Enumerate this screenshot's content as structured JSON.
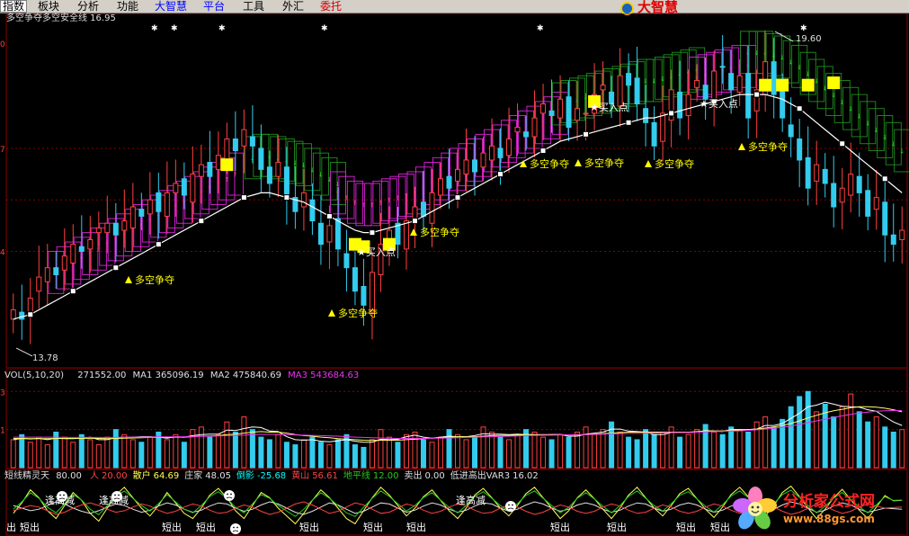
{
  "menu": {
    "items": [
      {
        "label": "指数",
        "style": "first"
      },
      {
        "label": "板块",
        "style": ""
      },
      {
        "label": "分析",
        "style": ""
      },
      {
        "label": "功能",
        "style": ""
      },
      {
        "label": "大智慧",
        "style": "hl"
      },
      {
        "label": "平台",
        "style": "hl"
      },
      {
        "label": "工具",
        "style": ""
      },
      {
        "label": "外汇",
        "style": ""
      },
      {
        "label": "委托",
        "style": "red"
      }
    ],
    "brand": "大智慧"
  },
  "colors": {
    "up": "#ff4040",
    "down": "#33ccee",
    "white": "#ffffff",
    "magenta": "#dd22dd",
    "green": "#1f8f1f",
    "yellow": "#ffff00",
    "vol_ma2": "#ffff66",
    "vol_ma3": "#ee33ee",
    "grid": "#8b0000"
  },
  "main_panel": {
    "title": "多空争夺多空安全线 16.95",
    "axis_labels": [
      "0",
      "7",
      "4"
    ],
    "high_label": "19.60",
    "low_label": "13.78",
    "signal_text": "多空争夺",
    "buy_text": "买入点"
  },
  "volume_panel": {
    "title": "VOL(5,10,20)",
    "volume": "271552.00",
    "ma1_label": "MA1",
    "ma1": "365096.19",
    "ma2_label": "MA2",
    "ma2": "475840.69",
    "ma3_label": "MA3",
    "ma3": "543684.63",
    "axis_labels": [
      "3",
      "1"
    ]
  },
  "indicator_panel": {
    "name": "短线精灵天",
    "name_value": "80.00",
    "fields": [
      {
        "label": "人",
        "value": "20.00",
        "color": "#ff4444"
      },
      {
        "label": "散户",
        "value": "64.69",
        "color": "#ffff55"
      },
      {
        "label": "庄家",
        "value": "48.05",
        "color": "#e0e0e0"
      },
      {
        "label": "倒影",
        "value": "-25.68",
        "color": "#00ffff"
      },
      {
        "label": "黄山",
        "value": "56.61",
        "color": "#ff4444"
      },
      {
        "label": "地平线",
        "value": "12.00",
        "color": "#22cc22"
      },
      {
        "label": "卖出",
        "value": "0.00",
        "color": "#e0e0e0"
      },
      {
        "label": "低进高出VAR3",
        "value": "16.02",
        "color": "#e0e0e0"
      }
    ],
    "marker_text_short": "短出",
    "marker_text_reduce": "逢高减",
    "partial_label": "出"
  },
  "watermark": {
    "title": "分析家公式网",
    "url": "www.88gs.com"
  },
  "chart_data": [
    {
      "type": "candlestick",
      "title": "多空争夺多空安全线 16.95",
      "ylim": [
        13.0,
        20.3
      ],
      "high": 19.6,
      "low": 13.78,
      "close": [
        14.2,
        14.0,
        14.45,
        14.9,
        15.1,
        14.95,
        15.35,
        15.6,
        15.45,
        15.7,
        15.95,
        16.05,
        15.8,
        16.1,
        16.4,
        16.2,
        16.55,
        16.3,
        16.7,
        16.9,
        16.65,
        17.1,
        17.3,
        17.05,
        17.5,
        17.85,
        17.6,
        18.05,
        17.7,
        17.2,
        16.9,
        17.35,
        16.6,
        16.3,
        16.7,
        16.1,
        15.6,
        16.0,
        15.5,
        15.1,
        14.6,
        14.3,
        15.0,
        15.6,
        15.9,
        15.6,
        16.1,
        16.4,
        16.2,
        16.7,
        17.0,
        16.8,
        17.2,
        17.4,
        17.15,
        17.55,
        17.7,
        17.45,
        17.85,
        18.1,
        17.9,
        18.3,
        18.6,
        18.35,
        18.7,
        18.1,
        18.5,
        18.4,
        18.8,
        19.0,
        18.6,
        19.2,
        19.0,
        18.6,
        18.2,
        17.7,
        18.4,
        18.9,
        18.3,
        18.8,
        19.1,
        18.7,
        19.3,
        19.4,
        18.9,
        19.2,
        18.3,
        18.9,
        19.5,
        18.8,
        18.3,
        17.9,
        17.4,
        16.8,
        17.3,
        16.9,
        16.4,
        16.8,
        17.1,
        16.7,
        16.2,
        16.6,
        15.8,
        15.6,
        15.9
      ],
      "safety_line": [
        14.0,
        14.05,
        14.1,
        14.2,
        14.3,
        14.4,
        14.5,
        14.6,
        14.7,
        14.8,
        14.9,
        15.0,
        15.1,
        15.2,
        15.3,
        15.4,
        15.5,
        15.6,
        15.7,
        15.8,
        15.9,
        16.0,
        16.1,
        16.2,
        16.3,
        16.4,
        16.5,
        16.6,
        16.65,
        16.7,
        16.7,
        16.65,
        16.6,
        16.55,
        16.5,
        16.4,
        16.3,
        16.2,
        16.1,
        16.0,
        15.9,
        15.85,
        15.85,
        15.9,
        15.95,
        16.0,
        16.05,
        16.1,
        16.2,
        16.3,
        16.4,
        16.5,
        16.6,
        16.7,
        16.8,
        16.9,
        17.0,
        17.1,
        17.2,
        17.3,
        17.4,
        17.5,
        17.6,
        17.7,
        17.8,
        17.85,
        17.9,
        17.95,
        18.0,
        18.05,
        18.1,
        18.15,
        18.2,
        18.25,
        18.3,
        18.3,
        18.35,
        18.4,
        18.45,
        18.5,
        18.55,
        18.6,
        18.65,
        18.7,
        18.75,
        18.8,
        18.8,
        18.8,
        18.8,
        18.75,
        18.7,
        18.6,
        18.5,
        18.35,
        18.2,
        18.05,
        17.9,
        17.75,
        17.6,
        17.45,
        17.3,
        17.15,
        17.0,
        16.85,
        16.7
      ]
    },
    {
      "type": "bar",
      "title": "VOL(5,10,20)",
      "series": [
        {
          "name": "VOL",
          "values": [
            1.1,
            1.3,
            1.0,
            1.2,
            0.9,
            1.4,
            1.2,
            1.0,
            1.3,
            1.1,
            0.9,
            1.2,
            1.5,
            1.3,
            1.1,
            1.0,
            1.2,
            1.4,
            1.1,
            1.3,
            1.0,
            1.5,
            1.6,
            1.2,
            1.3,
            1.8,
            1.4,
            2.0,
            1.5,
            1.2,
            1.1,
            1.3,
            1.0,
            0.9,
            1.1,
            1.2,
            1.0,
            0.9,
            1.1,
            1.3,
            0.9,
            0.8,
            1.1,
            1.5,
            1.2,
            1.0,
            1.3,
            1.4,
            1.1,
            1.0,
            1.2,
            1.5,
            1.3,
            1.1,
            1.2,
            1.6,
            1.4,
            1.2,
            1.1,
            1.3,
            1.5,
            1.4,
            1.2,
            1.1,
            1.3,
            1.2,
            1.4,
            1.6,
            1.3,
            1.5,
            1.8,
            1.4,
            1.2,
            1.1,
            1.5,
            1.3,
            1.4,
            1.6,
            1.2,
            1.3,
            1.5,
            1.7,
            1.4,
            1.3,
            1.6,
            1.5,
            1.4,
            1.8,
            2.0,
            1.6,
            1.9,
            2.4,
            2.8,
            3.0,
            2.2,
            2.5,
            2.0,
            2.4,
            2.9,
            2.2,
            1.8,
            2.0,
            1.6,
            1.4,
            1.5
          ]
        },
        {
          "name": "MA1",
          "values": [
            1.1,
            1.15,
            1.13,
            1.15,
            1.1,
            1.16,
            1.14,
            1.14,
            1.16,
            1.2,
            1.1,
            1.1,
            1.18,
            1.2,
            1.2,
            1.22,
            1.22,
            1.2,
            1.16,
            1.22,
            1.2,
            1.26,
            1.3,
            1.32,
            1.32,
            1.48,
            1.46,
            1.54,
            1.6,
            1.58,
            1.44,
            1.42,
            1.22,
            1.1,
            1.08,
            1.1,
            1.04,
            1.02,
            1.06,
            1.1,
            1.04,
            1.0,
            1.0,
            1.12,
            1.1,
            1.12,
            1.22,
            1.28,
            1.2,
            1.16,
            1.2,
            1.24,
            1.22,
            1.22,
            1.26,
            1.34,
            1.32,
            1.32,
            1.3,
            1.32,
            1.3,
            1.3,
            1.28,
            1.3,
            1.3,
            1.24,
            1.24,
            1.32,
            1.36,
            1.4,
            1.52,
            1.52,
            1.44,
            1.42,
            1.4,
            1.3,
            1.3,
            1.38,
            1.4,
            1.38,
            1.4,
            1.46,
            1.44,
            1.42,
            1.5,
            1.5,
            1.5,
            1.52,
            1.66,
            1.66,
            1.74,
            1.94,
            2.14,
            2.4,
            2.46,
            2.58,
            2.5,
            2.42,
            2.4,
            2.38,
            2.28,
            2.22,
            2.0,
            1.8,
            1.66
          ]
        },
        {
          "name": "MA2",
          "values": [
            1.15,
            1.15,
            1.14,
            1.14,
            1.14,
            1.15,
            1.15,
            1.15,
            1.15,
            1.16,
            1.15,
            1.14,
            1.15,
            1.16,
            1.17,
            1.18,
            1.19,
            1.19,
            1.19,
            1.2,
            1.2,
            1.22,
            1.24,
            1.25,
            1.26,
            1.3,
            1.32,
            1.36,
            1.4,
            1.42,
            1.4,
            1.4,
            1.36,
            1.3,
            1.26,
            1.24,
            1.2,
            1.18,
            1.14,
            1.12,
            1.1,
            1.08,
            1.07,
            1.08,
            1.08,
            1.08,
            1.1,
            1.12,
            1.14,
            1.16,
            1.18,
            1.2,
            1.22,
            1.22,
            1.22,
            1.24,
            1.26,
            1.27,
            1.27,
            1.28,
            1.3,
            1.3,
            1.3,
            1.3,
            1.3,
            1.29,
            1.29,
            1.3,
            1.32,
            1.34,
            1.36,
            1.38,
            1.4,
            1.4,
            1.4,
            1.4,
            1.4,
            1.4,
            1.4,
            1.4,
            1.42,
            1.44,
            1.44,
            1.45,
            1.46,
            1.48,
            1.5,
            1.52,
            1.56,
            1.6,
            1.66,
            1.74,
            1.84,
            1.96,
            2.06,
            2.16,
            2.24,
            2.3,
            2.36,
            2.4,
            2.4,
            2.38,
            2.34,
            2.28,
            2.2
          ]
        },
        {
          "name": "MA3",
          "values": [
            1.2,
            1.2,
            1.2,
            1.2,
            1.2,
            1.2,
            1.19,
            1.19,
            1.19,
            1.19,
            1.19,
            1.19,
            1.19,
            1.2,
            1.2,
            1.2,
            1.2,
            1.21,
            1.21,
            1.21,
            1.22,
            1.22,
            1.23,
            1.24,
            1.25,
            1.26,
            1.27,
            1.28,
            1.3,
            1.31,
            1.31,
            1.31,
            1.3,
            1.29,
            1.28,
            1.27,
            1.26,
            1.25,
            1.24,
            1.22,
            1.2,
            1.19,
            1.18,
            1.17,
            1.16,
            1.15,
            1.15,
            1.15,
            1.15,
            1.16,
            1.16,
            1.17,
            1.18,
            1.19,
            1.2,
            1.21,
            1.22,
            1.23,
            1.24,
            1.25,
            1.26,
            1.27,
            1.28,
            1.28,
            1.29,
            1.29,
            1.3,
            1.3,
            1.31,
            1.32,
            1.33,
            1.34,
            1.35,
            1.35,
            1.36,
            1.36,
            1.37,
            1.38,
            1.38,
            1.39,
            1.4,
            1.41,
            1.42,
            1.43,
            1.44,
            1.45,
            1.47,
            1.49,
            1.52,
            1.55,
            1.59,
            1.64,
            1.7,
            1.77,
            1.84,
            1.91,
            1.98,
            2.04,
            2.1,
            2.15,
            2.19,
            2.22,
            2.24,
            2.25,
            2.25
          ]
        }
      ],
      "ylim": [
        0,
        3.4
      ]
    },
    {
      "type": "line",
      "title": "短线精灵天",
      "ylim": [
        0,
        100
      ],
      "series": [
        {
          "name": "散户",
          "values": [
            40,
            60,
            85,
            70,
            45,
            30,
            55,
            80,
            65,
            40,
            25,
            50,
            75,
            90,
            70,
            50,
            35,
            55,
            80,
            60,
            40,
            30,
            50,
            75,
            88,
            70,
            45,
            30,
            55,
            80,
            70,
            50,
            35,
            20,
            40,
            65,
            85,
            70,
            50,
            30,
            20,
            45,
            70,
            90,
            75,
            55,
            35,
            50,
            72,
            85,
            65,
            45,
            30,
            50,
            75,
            88,
            70,
            50,
            35,
            55,
            78,
            90,
            70,
            50,
            30,
            45,
            70,
            85,
            68,
            48,
            30,
            50,
            75,
            90,
            70,
            50,
            35,
            55,
            78,
            88,
            68,
            48,
            32,
            52,
            76,
            90,
            72,
            52,
            35,
            55,
            80,
            92,
            72,
            50,
            30,
            48,
            70,
            86,
            66,
            46,
            30,
            52,
            74,
            64,
            65
          ]
        },
        {
          "name": "庄家",
          "values": [
            55,
            50,
            45,
            48,
            55,
            62,
            58,
            50,
            44,
            40,
            45,
            52,
            58,
            55,
            48,
            42,
            46,
            54,
            60,
            56,
            48,
            42,
            46,
            54,
            60,
            58,
            50,
            44,
            48,
            56,
            62,
            58,
            50,
            42,
            38,
            44,
            52,
            60,
            56,
            48,
            40,
            44,
            52,
            60,
            58,
            50,
            42,
            46,
            54,
            60,
            56,
            48,
            42,
            46,
            54,
            60,
            58,
            50,
            44,
            48,
            56,
            62,
            58,
            50,
            44,
            48,
            56,
            60,
            56,
            48,
            42,
            46,
            54,
            60,
            58,
            50,
            44,
            48,
            56,
            60,
            56,
            48,
            42,
            46,
            54,
            60,
            58,
            50,
            44,
            48,
            56,
            62,
            58,
            50,
            42,
            46,
            54,
            60,
            56,
            48,
            42,
            46,
            50,
            49,
            48
          ]
        }
      ]
    }
  ]
}
